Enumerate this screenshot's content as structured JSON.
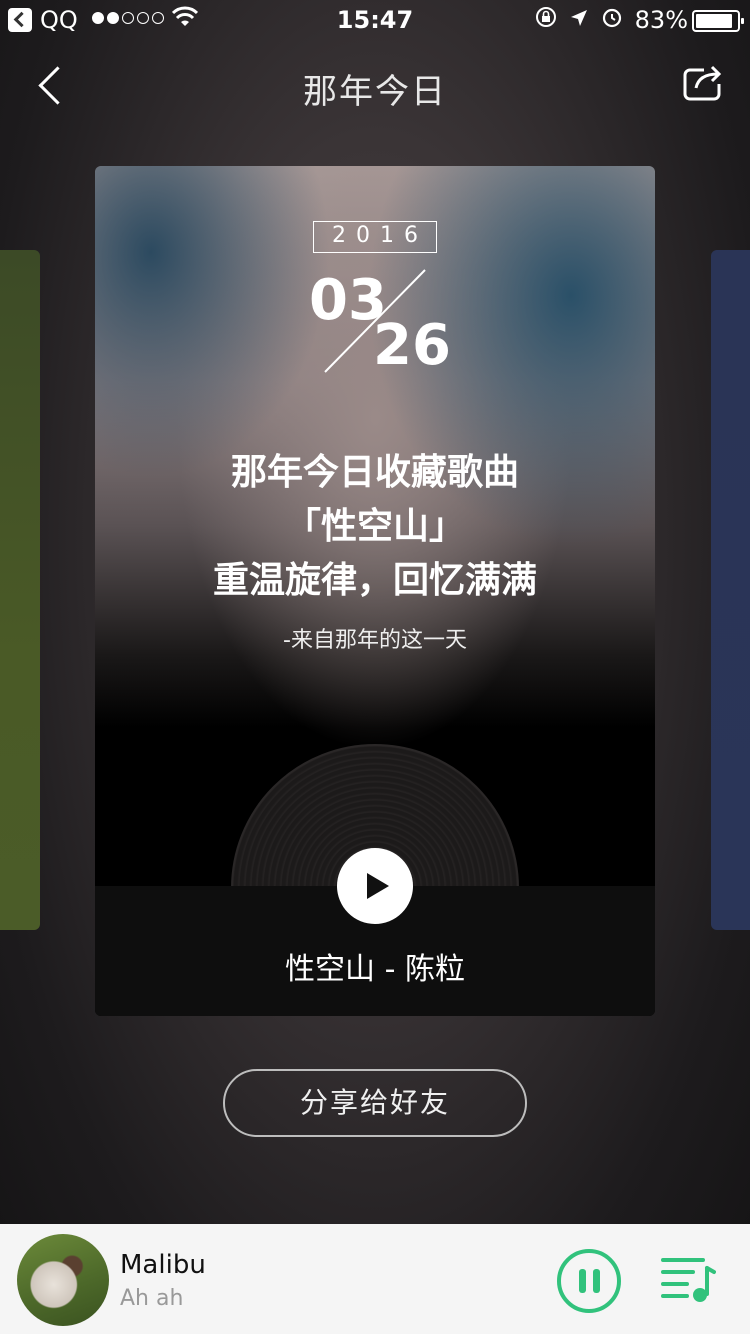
{
  "status_bar": {
    "carrier": "QQ",
    "time": "15:47",
    "battery": "83%",
    "signal_bars_filled": 2,
    "signal_bars_total": 5
  },
  "nav": {
    "title": "那年今日"
  },
  "card": {
    "year": "2016",
    "month": "03",
    "day": "26",
    "headline_line1": "那年今日收藏歌曲",
    "headline_line2": "「性空山」",
    "headline_line3": "重温旋律，回忆满满",
    "from_text": "-来自那年的这一天",
    "song_line": "性空山 - 陈粒"
  },
  "share_button": {
    "label": "分享给好友"
  },
  "mini_player": {
    "title": "Malibu",
    "subtitle": "Ah ah",
    "accent_color": "#31c27c"
  },
  "icons": {
    "back": "chevron-left-icon",
    "share": "share-icon",
    "play": "play-icon",
    "pause": "pause-icon",
    "playlist": "playlist-icon"
  }
}
